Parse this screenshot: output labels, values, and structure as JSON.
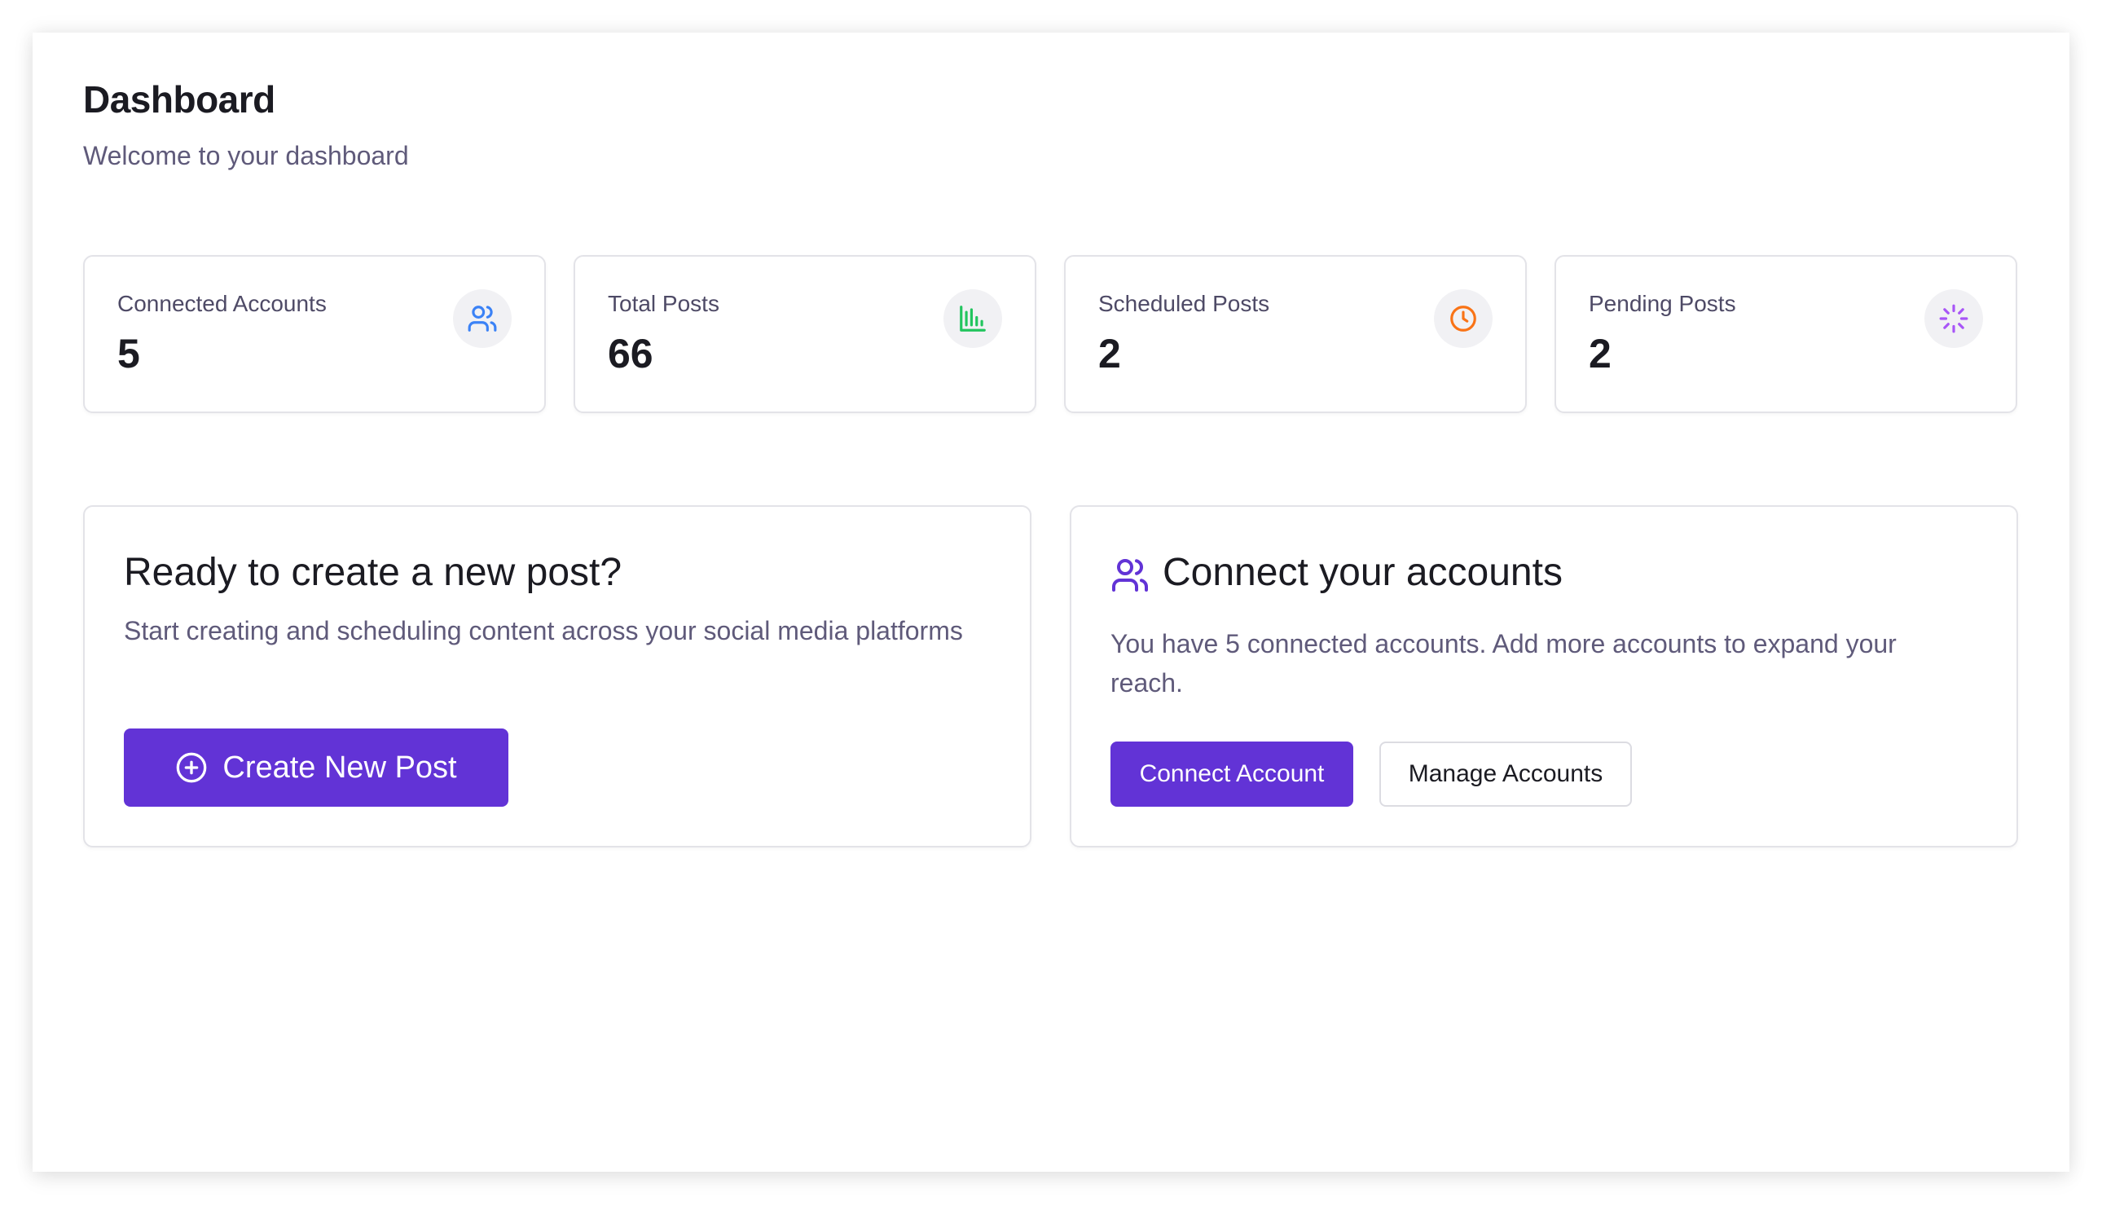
{
  "header": {
    "title": "Dashboard",
    "subtitle": "Welcome to your dashboard"
  },
  "stats": [
    {
      "label": "Connected Accounts",
      "value": "5",
      "icon": "users-icon",
      "color": "#3b82f6"
    },
    {
      "label": "Total Posts",
      "value": "66",
      "icon": "bar-chart-icon",
      "color": "#22c55e"
    },
    {
      "label": "Scheduled Posts",
      "value": "2",
      "icon": "clock-icon",
      "color": "#f97316"
    },
    {
      "label": "Pending Posts",
      "value": "2",
      "icon": "loader-icon",
      "color": "#a855f7"
    }
  ],
  "create_post": {
    "title": "Ready to create a new post?",
    "description": "Start creating and scheduling content across your social media platforms",
    "button_label": "Create New Post",
    "button_icon": "plus-circle-icon"
  },
  "connect_accounts": {
    "title": "Connect your accounts",
    "title_icon": "users-icon",
    "description": "You have 5 connected accounts. Add more accounts to expand your reach.",
    "primary_button_label": "Connect Account",
    "secondary_button_label": "Manage Accounts"
  },
  "colors": {
    "accent": "#6233d6",
    "text": "#1b1b22",
    "muted": "#5f5a7a",
    "border": "#e3e3e8"
  }
}
